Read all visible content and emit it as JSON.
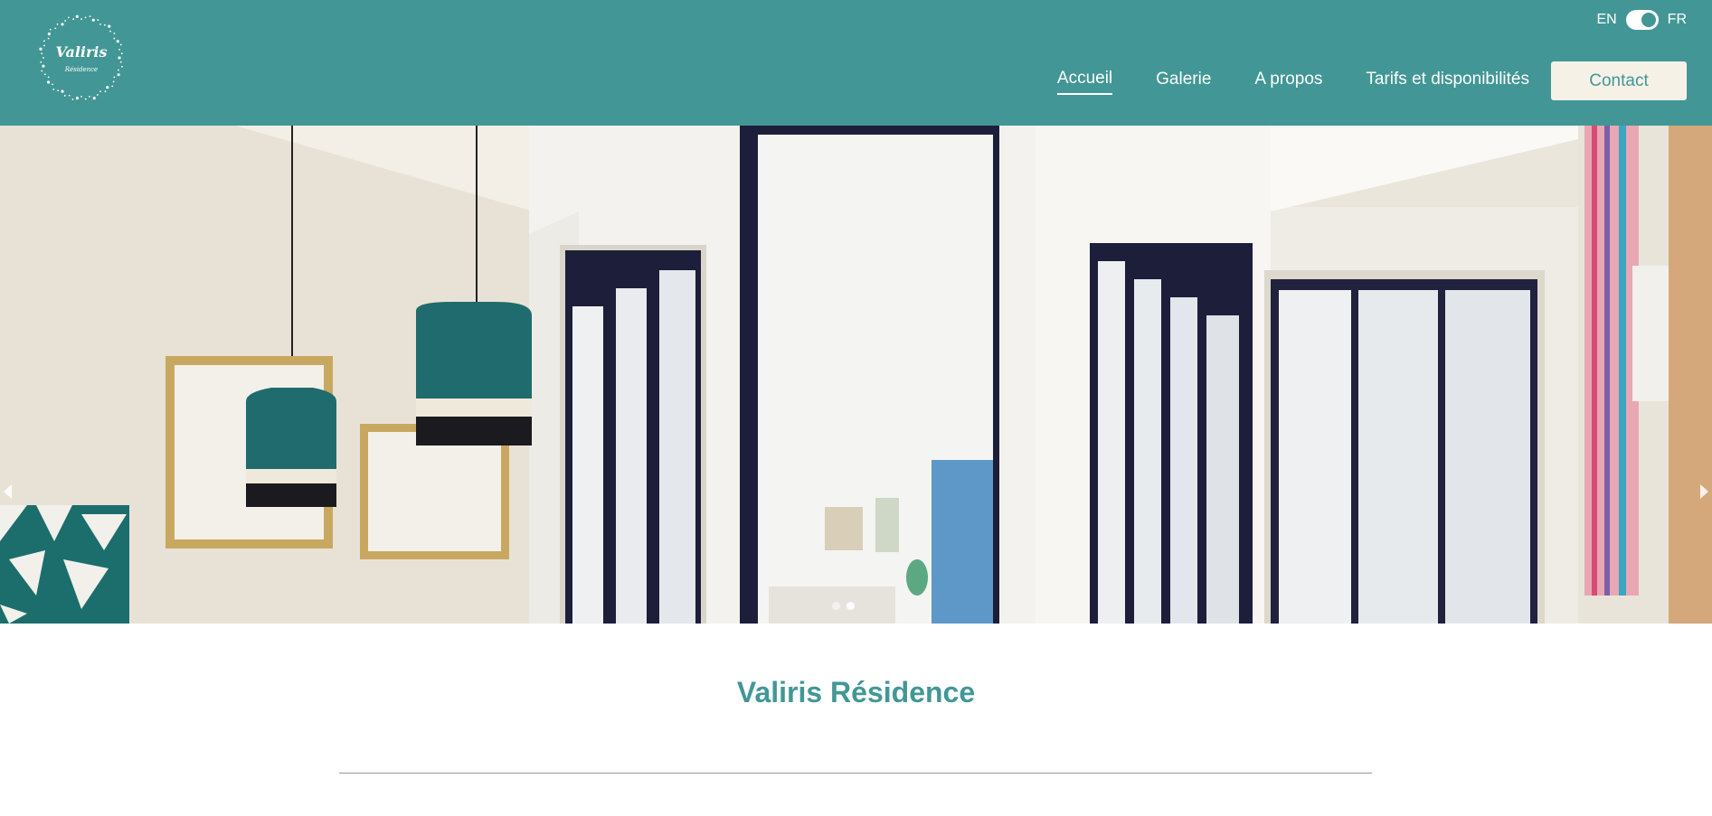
{
  "colors": {
    "accent": "#429796",
    "button_bg": "#f6f1e7"
  },
  "header": {
    "logo": {
      "name": "Valiris",
      "subtitle": "Résidence"
    },
    "language": {
      "left": "EN",
      "right": "FR",
      "selected": "FR"
    },
    "nav": {
      "accueil": "Accueil",
      "galerie": "Galerie",
      "a_propos": "A propos",
      "tarifs": "Tarifs et disponibilités",
      "contact": "Contact"
    }
  },
  "hero": {
    "icons": {
      "prev": "arrow-left-icon",
      "next": "arrow-right-icon"
    },
    "slide_count": 2,
    "active_slide": 2
  },
  "main": {
    "title": "Valiris Résidence"
  }
}
